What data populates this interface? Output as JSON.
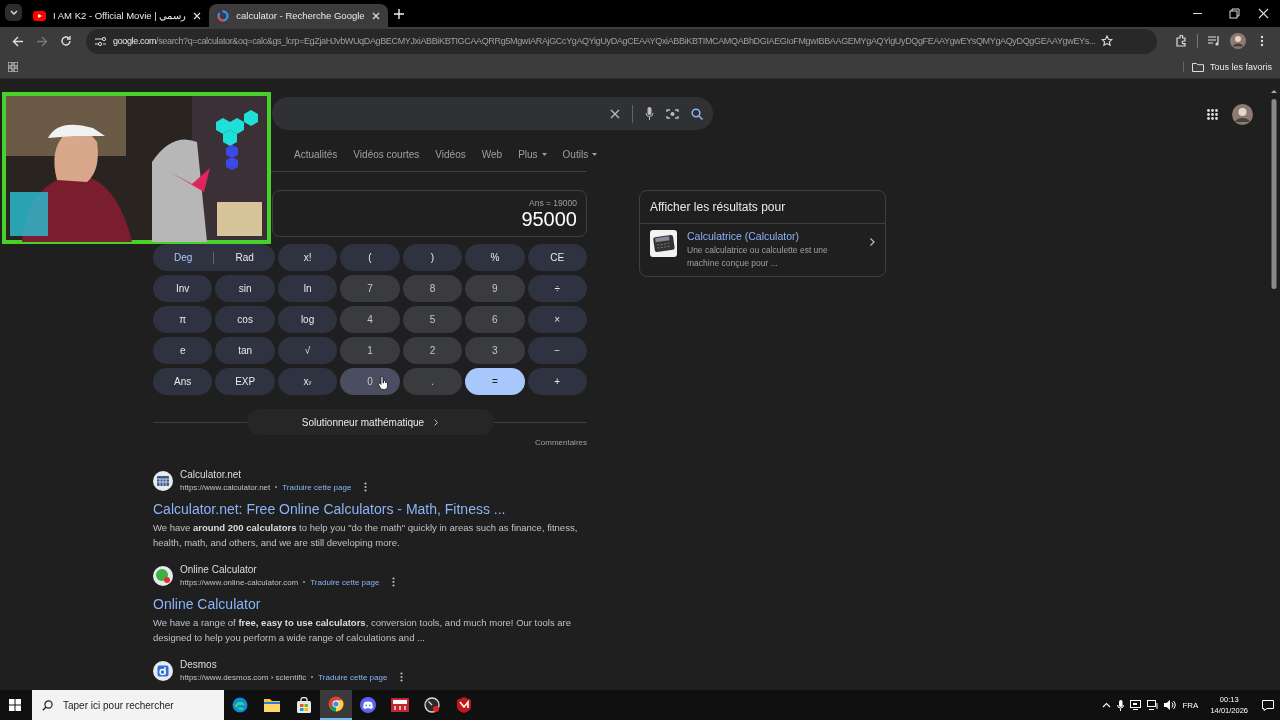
{
  "browser": {
    "tabs": [
      {
        "title": "I AM K2 - Official Movie | رسمي",
        "kind": "video",
        "selected": false
      },
      {
        "title": "calculator - Recherche Google",
        "kind": "search",
        "selected": true
      }
    ],
    "url_host": "google.com",
    "url_path": "/search?q=calculator&oq=calc&gs_lcrp=EgZjaHJvbWUqDAgBECMYJxiABBiKBTIGCAAQRRg5MgwIARAjGCcYgAQYigUyDAgCEAAYQxiABBiKBTIMCAMQABhDGIAEGIoFMgwIBBAAGEMYgAQYigUyDQgFEAAYgwEYsQMYgAQyDQgGEAAYgwEYs...",
    "bookmarks_folder": "Tous les favoris"
  },
  "search_nav": [
    {
      "label": "Actualités",
      "dropdown": false
    },
    {
      "label": "Vidéos courtes",
      "dropdown": false
    },
    {
      "label": "Vidéos",
      "dropdown": false
    },
    {
      "label": "Web",
      "dropdown": false
    },
    {
      "label": "Plus",
      "dropdown": true
    },
    {
      "label": "Outils",
      "dropdown": true
    }
  ],
  "calculator": {
    "previous": "Ans = 19000",
    "result": "95000",
    "keys": [
      {
        "kind": "mode",
        "hovered": false,
        "options": [
          {
            "label": "Deg",
            "selected": true
          },
          {
            "label": "Rad",
            "selected": false
          }
        ]
      },
      {
        "kind": "func",
        "label": "x!",
        "hovered": false
      },
      {
        "kind": "func",
        "label": "(",
        "hovered": false
      },
      {
        "kind": "func",
        "label": ")",
        "hovered": false
      },
      {
        "kind": "func",
        "label": "%",
        "hovered": false
      },
      {
        "kind": "func",
        "label": "CE",
        "hovered": false
      },
      {
        "kind": "func",
        "label": "Inv",
        "hovered": false
      },
      {
        "kind": "func",
        "label": "sin",
        "hovered": false
      },
      {
        "kind": "func",
        "label": "ln",
        "hovered": false
      },
      {
        "kind": "num",
        "label": "7",
        "hovered": false
      },
      {
        "kind": "num",
        "label": "8",
        "hovered": false
      },
      {
        "kind": "num",
        "label": "9",
        "hovered": false
      },
      {
        "kind": "func",
        "label": "÷",
        "hovered": false
      },
      {
        "kind": "func",
        "label": "π",
        "hovered": false
      },
      {
        "kind": "func",
        "label": "cos",
        "hovered": false
      },
      {
        "kind": "func",
        "label": "log",
        "hovered": false
      },
      {
        "kind": "num",
        "label": "4",
        "hovered": false
      },
      {
        "kind": "num",
        "label": "5",
        "hovered": false
      },
      {
        "kind": "num",
        "label": "6",
        "hovered": false
      },
      {
        "kind": "func",
        "label": "×",
        "hovered": false
      },
      {
        "kind": "func",
        "label": "e",
        "hovered": false
      },
      {
        "kind": "func",
        "label": "tan",
        "hovered": false
      },
      {
        "kind": "func",
        "label": "√",
        "hovered": false
      },
      {
        "kind": "num",
        "label": "1",
        "hovered": false
      },
      {
        "kind": "num",
        "label": "2",
        "hovered": false
      },
      {
        "kind": "num",
        "label": "3",
        "hovered": false
      },
      {
        "kind": "func",
        "label": "−",
        "hovered": false
      },
      {
        "kind": "func",
        "label": "Ans",
        "hovered": false
      },
      {
        "kind": "func",
        "label": "EXP",
        "hovered": false
      },
      {
        "kind": "func",
        "label": "x$^{y}$",
        "hovered": false
      },
      {
        "kind": "num",
        "label": "0",
        "hovered": true
      },
      {
        "kind": "num",
        "label": ".",
        "hovered": false
      },
      {
        "kind": "equals",
        "label": "=",
        "hovered": false
      },
      {
        "kind": "func",
        "label": "+",
        "hovered": false
      }
    ],
    "solver": "Solutionneur mathématique",
    "feedback": "Commentaires"
  },
  "results": [
    {
      "kind": "grid",
      "site": "Calculator.net",
      "url": "https://www.calculator.net",
      "translate": "Traduire cette page",
      "title": "Calculator.net: Free Online Calculators - Math, Fitness ...",
      "snippet": "We have **around 200 calculators** to help you \"do the math\" quickly in areas such as finance, fitness, health, math, and others, and we are still developing more."
    },
    {
      "kind": "green",
      "site": "Online Calculator",
      "url": "https://www.online-calculator.com",
      "translate": "Traduire cette page",
      "title": "Online Calculator",
      "snippet": "We have a range of **free, easy to use calculators**, conversion tools, and much more! Our tools are designed to help you perform a wide range of calculations and ..."
    },
    {
      "kind": "blue",
      "site": "Desmos",
      "url": "https://www.desmos.com › scientific",
      "translate": "Traduire cette page"
    }
  ],
  "knowledge": {
    "heading": "Afficher les résultats pour",
    "title": "Calculatrice (Calculator)",
    "description": "Une calculatrice ou calculette est une machine conçue pour ..."
  },
  "taskbar": {
    "search_placeholder": "Taper ici pour rechercher",
    "apps": [
      {
        "kind": "edge",
        "active": false
      },
      {
        "kind": "folder",
        "active": false
      },
      {
        "kind": "store",
        "active": false
      },
      {
        "kind": "chrome",
        "active": true
      },
      {
        "kind": "chat",
        "active": false
      },
      {
        "kind": "mixer",
        "active": false
      },
      {
        "kind": "gauge",
        "active": false
      },
      {
        "kind": "shield",
        "active": false
      }
    ],
    "language": "FRA",
    "time": "00:13",
    "date": "14/01/2026"
  }
}
